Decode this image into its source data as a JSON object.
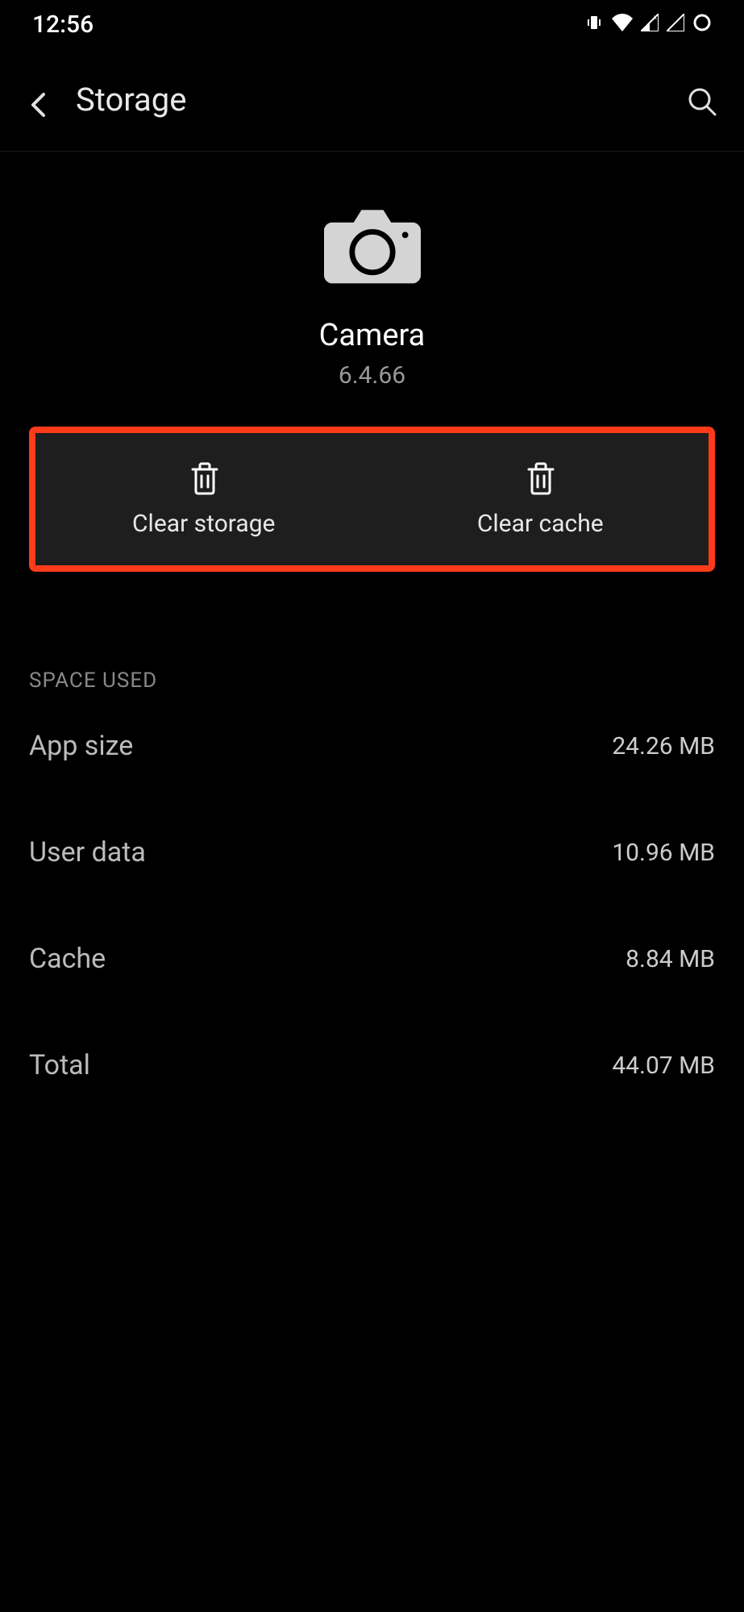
{
  "status": {
    "time": "12:56"
  },
  "header": {
    "title": "Storage"
  },
  "app": {
    "name": "Camera",
    "version": "6.4.66"
  },
  "actions": {
    "clear_storage": "Clear storage",
    "clear_cache": "Clear cache"
  },
  "section": {
    "title": "SPACE USED"
  },
  "rows": [
    {
      "label": "App size",
      "value": "24.26 MB"
    },
    {
      "label": "User data",
      "value": "10.96 MB"
    },
    {
      "label": "Cache",
      "value": "8.84 MB"
    },
    {
      "label": "Total",
      "value": "44.07 MB"
    }
  ]
}
